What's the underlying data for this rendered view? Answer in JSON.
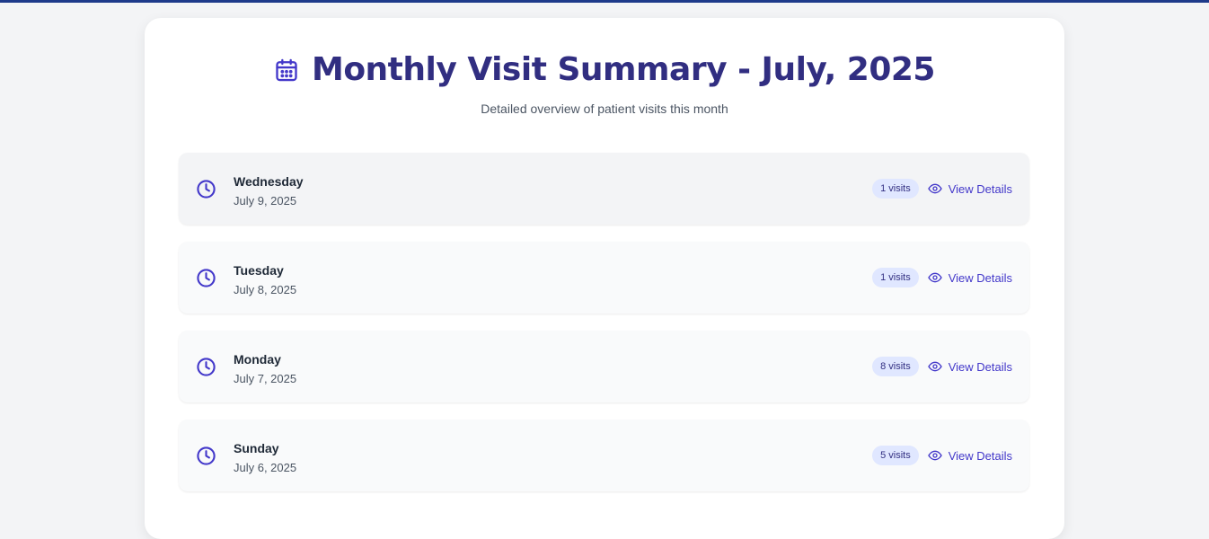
{
  "header": {
    "title": "Monthly Visit Summary - July, 2025",
    "subtitle": "Detailed overview of patient visits this month",
    "icon": "calendar-icon"
  },
  "colors": {
    "accent": "#4338ca",
    "title": "#312e81",
    "badge_bg": "#e0e7ff",
    "top_bar": "#1e3a8a"
  },
  "visits": [
    {
      "day": "Wednesday",
      "date": "July 9, 2025",
      "badge": "1 visits",
      "action": "View Details"
    },
    {
      "day": "Tuesday",
      "date": "July 8, 2025",
      "badge": "1 visits",
      "action": "View Details"
    },
    {
      "day": "Monday",
      "date": "July 7, 2025",
      "badge": "8 visits",
      "action": "View Details"
    },
    {
      "day": "Sunday",
      "date": "July 6, 2025",
      "badge": "5 visits",
      "action": "View Details"
    }
  ]
}
